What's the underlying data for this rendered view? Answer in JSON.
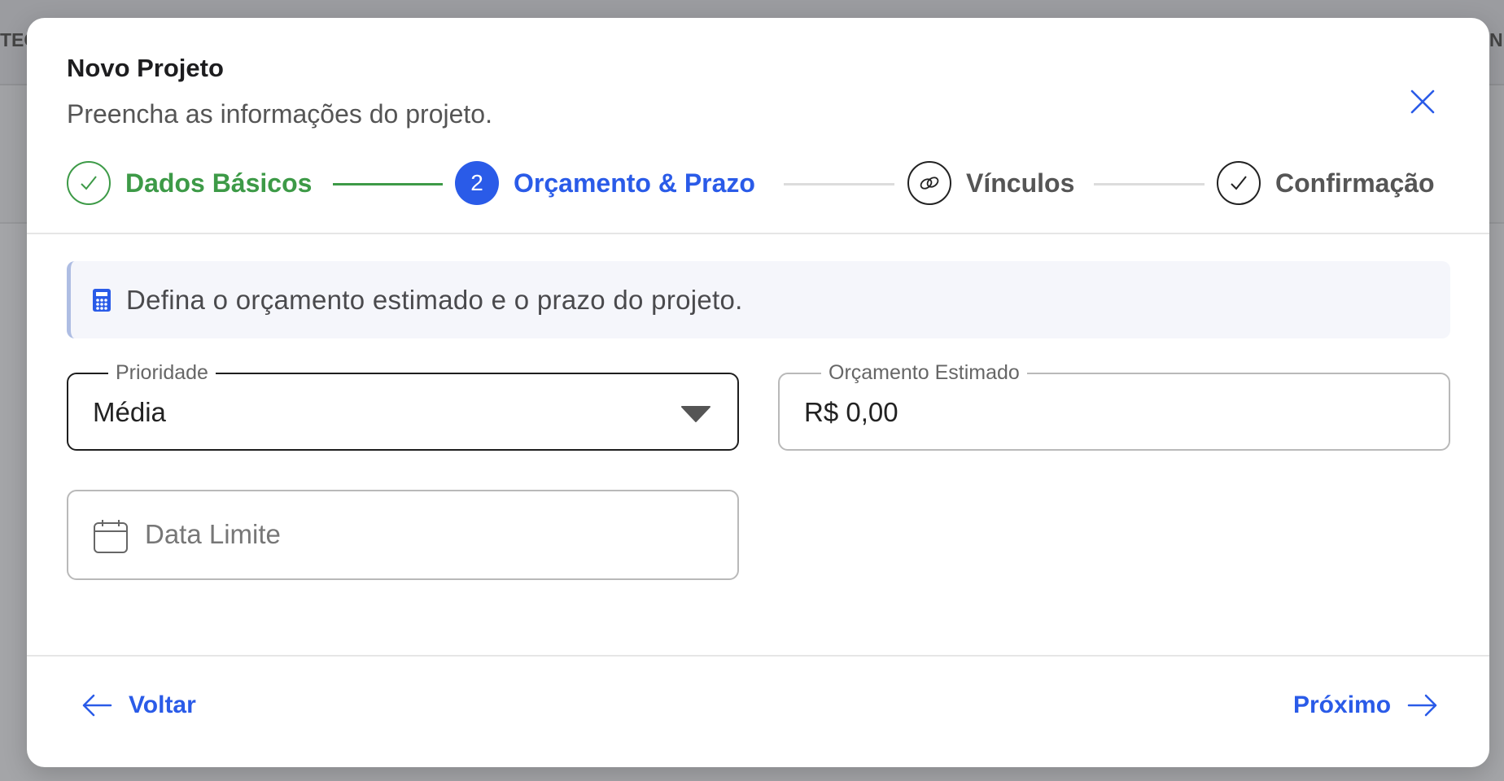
{
  "background": {
    "left_fragment": "TEC",
    "right_fragment": "N"
  },
  "dialog": {
    "title": "Novo Projeto",
    "subtitle": "Preencha as informações do projeto."
  },
  "stepper": {
    "steps": [
      {
        "label": "Dados Básicos",
        "status": "completed",
        "icon": "check-icon"
      },
      {
        "label": "Orçamento & Prazo",
        "status": "active",
        "number": "2"
      },
      {
        "label": "Vínculos",
        "status": "pending",
        "icon": "link-icon"
      },
      {
        "label": "Confirmação",
        "status": "pending",
        "icon": "check-icon"
      }
    ]
  },
  "info": {
    "text": "Defina o orçamento estimado e o prazo do projeto.",
    "icon": "calculator-icon"
  },
  "form": {
    "priority": {
      "label": "Prioridade",
      "value": "Média"
    },
    "budget": {
      "label": "Orçamento Estimado",
      "value": "R$ 0,00"
    },
    "deadline": {
      "placeholder": "Data Limite",
      "icon": "calendar-icon"
    }
  },
  "footer": {
    "back_label": "Voltar",
    "next_label": "Próximo"
  },
  "colors": {
    "completed": "#3d9a47",
    "active": "#2a5be8",
    "pending": "#555555",
    "link": "#2a5be8"
  }
}
